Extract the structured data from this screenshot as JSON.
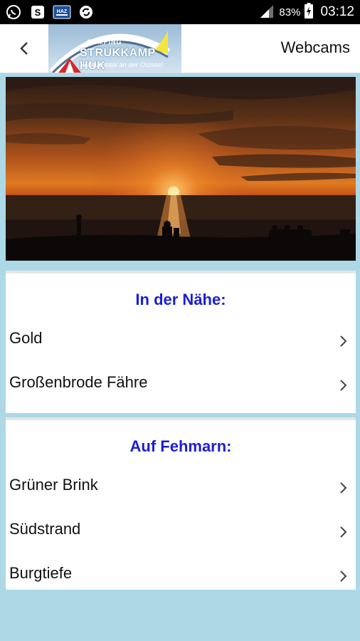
{
  "status_bar": {
    "battery": "83%",
    "time": "03:12",
    "notification_icons": [
      "whatsapp-icon",
      "skype-icon",
      "news-app-icon",
      "sync-icon"
    ],
    "system_icons": [
      "signal-icon",
      "battery-charging-icon"
    ]
  },
  "app_bar": {
    "title": "Webcams",
    "logo": {
      "line1": "CAMPING",
      "line2": "STRUKKAMP HUK",
      "line3": "Urlaub total an der Ostsee!"
    }
  },
  "sections": [
    {
      "title": "In der Nähe:",
      "items": [
        {
          "label": "Gold"
        },
        {
          "label": "Großenbrode Fähre"
        }
      ]
    },
    {
      "title": "Auf Fehmarn:",
      "items": [
        {
          "label": "Grüner Brink"
        },
        {
          "label": "Südstrand"
        },
        {
          "label": "Burgtiefe"
        }
      ]
    }
  ],
  "colors": {
    "background": "#add8e6",
    "section_title": "#1a1fd4",
    "status_bar": "#000000"
  }
}
